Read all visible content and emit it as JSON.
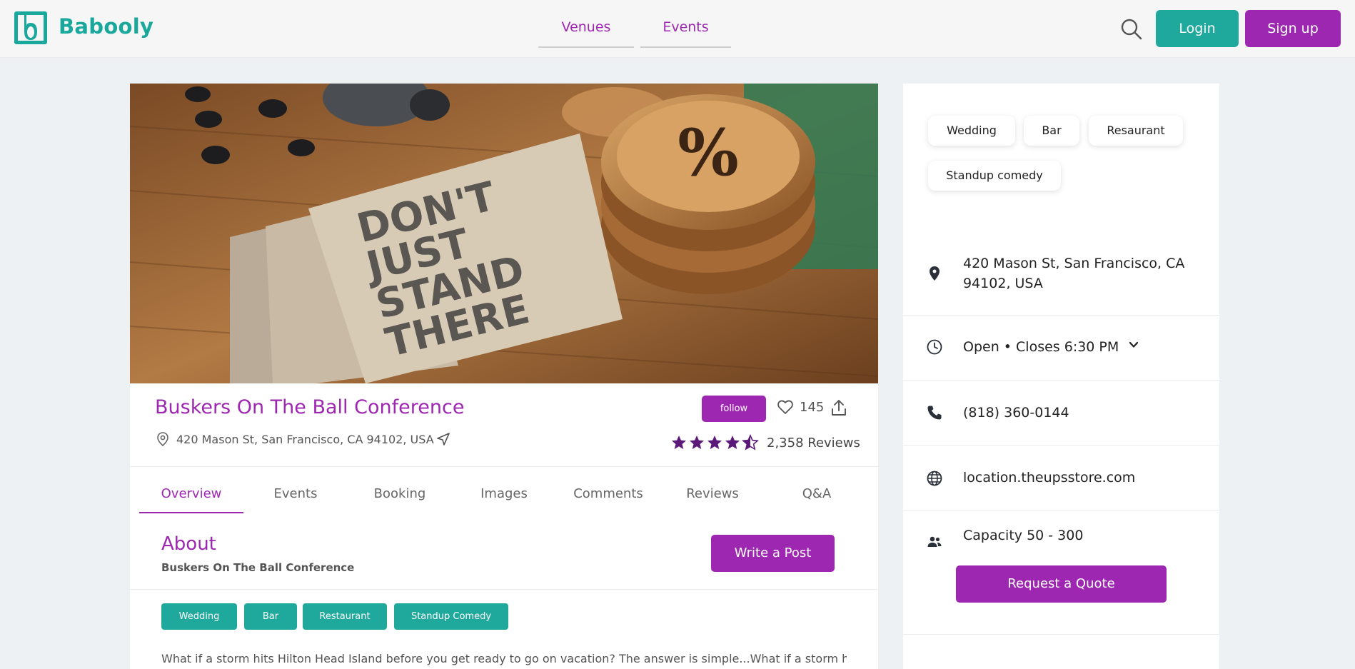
{
  "header": {
    "brand": "Babooly",
    "nav": [
      "Venues",
      "Events"
    ],
    "login_label": "Login",
    "signup_label": "Sign up"
  },
  "venue": {
    "title": "Buskers On The Ball Conference",
    "address": "420 Mason St, San Francisco, CA 94102, USA",
    "follow_label": "follow",
    "likes": "145",
    "rating": 4.5,
    "reviews": "2,358 Reviews",
    "tabs": [
      "Overview",
      "Events",
      "Booking",
      "Images",
      "Comments",
      "Reviews",
      "Q&A"
    ],
    "active_tab": "Overview",
    "about_title": "About",
    "about_subtitle": "Buskers On The Ball Conference",
    "write_post_label": "Write a Post",
    "tags": [
      "Wedding",
      "Bar",
      "Restaurant",
      "Standup Comedy"
    ],
    "description": "What if a storm hits Hilton Head Island before you get ready to go on vacation? The answer is simple...What if a storm hits",
    "hero_text": [
      "DON'T",
      "JUST",
      "STAND",
      "THERE"
    ]
  },
  "sidebar": {
    "chips": [
      "Wedding",
      "Bar",
      "Resaurant",
      "Standup comedy"
    ],
    "address_line1": "420 Mason St, San Francisco, CA",
    "address_line2": "94102, USA",
    "hours": "Open • Closes 6:30 PM",
    "phone": "(818) 360-0144",
    "website": "location.theupsstore.com",
    "capacity": "Capacity 50 - 300",
    "quote_label": "Request a Quote"
  },
  "colors": {
    "primary_purple": "#9d27b0",
    "primary_teal": "#1fa89c",
    "star_purple": "#5b1a7a",
    "background": "#eef1f4"
  }
}
